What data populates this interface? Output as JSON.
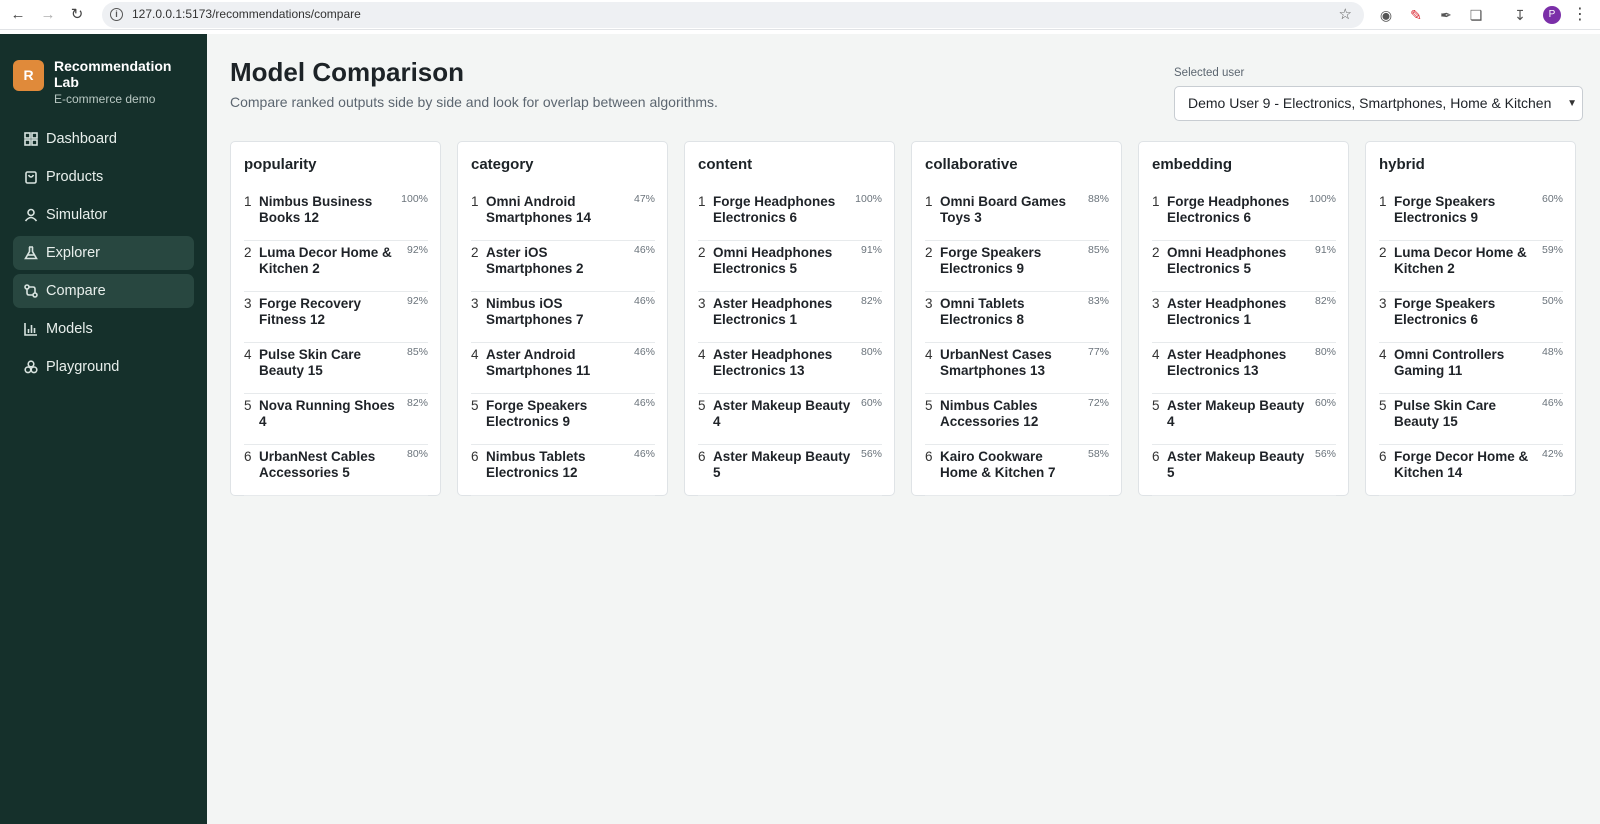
{
  "browser": {
    "url": "127.0.0.1:5173/recommendations/compare",
    "profile_initial": "P"
  },
  "sidebar": {
    "logo_letter": "R",
    "brand_title": "Recommendation Lab",
    "brand_subtitle": "E-commerce demo",
    "items": [
      {
        "label": "Dashboard",
        "icon": "dashboard-icon",
        "active": false
      },
      {
        "label": "Products",
        "icon": "bag-icon",
        "active": false
      },
      {
        "label": "Simulator",
        "icon": "user-icon",
        "active": false
      },
      {
        "label": "Explorer",
        "icon": "flask-icon",
        "active": true
      },
      {
        "label": "Compare",
        "icon": "compare-icon",
        "active": true
      },
      {
        "label": "Models",
        "icon": "bar-chart-icon",
        "active": false
      },
      {
        "label": "Playground",
        "icon": "circles-icon",
        "active": false
      }
    ]
  },
  "main": {
    "title": "Model Comparison",
    "subtitle": "Compare ranked outputs side by side and look for overlap between algorithms.",
    "user_select_label": "Selected user",
    "user_select_value": "Demo User 9 - Electronics, Smartphones, Home & Kitchen"
  },
  "models": [
    {
      "name": "popularity",
      "items": [
        {
          "rank": "1",
          "name": "Nimbus Business Books 12",
          "score": "100%"
        },
        {
          "rank": "2",
          "name": "Luma Decor Home & Kitchen 2",
          "score": "92%"
        },
        {
          "rank": "3",
          "name": "Forge Recovery Fitness 12",
          "score": "92%"
        },
        {
          "rank": "4",
          "name": "Pulse Skin Care Beauty 15",
          "score": "85%"
        },
        {
          "rank": "5",
          "name": "Nova Running Shoes 4",
          "score": "82%"
        },
        {
          "rank": "6",
          "name": "UrbanNest Cables Accessories 5",
          "score": "80%"
        }
      ]
    },
    {
      "name": "category",
      "items": [
        {
          "rank": "1",
          "name": "Omni Android Smartphones 14",
          "score": "47%"
        },
        {
          "rank": "2",
          "name": "Aster iOS Smartphones 2",
          "score": "46%"
        },
        {
          "rank": "3",
          "name": "Nimbus iOS Smartphones 7",
          "score": "46%"
        },
        {
          "rank": "4",
          "name": "Aster Android Smartphones 11",
          "score": "46%"
        },
        {
          "rank": "5",
          "name": "Forge Speakers Electronics 9",
          "score": "46%"
        },
        {
          "rank": "6",
          "name": "Nimbus Tablets Electronics 12",
          "score": "46%"
        }
      ]
    },
    {
      "name": "content",
      "items": [
        {
          "rank": "1",
          "name": "Forge Headphones Electronics 6",
          "score": "100%"
        },
        {
          "rank": "2",
          "name": "Omni Headphones Electronics 5",
          "score": "91%"
        },
        {
          "rank": "3",
          "name": "Aster Headphones Electronics 1",
          "score": "82%"
        },
        {
          "rank": "4",
          "name": "Aster Headphones Electronics 13",
          "score": "80%"
        },
        {
          "rank": "5",
          "name": "Aster Makeup Beauty 4",
          "score": "60%"
        },
        {
          "rank": "6",
          "name": "Aster Makeup Beauty 5",
          "score": "56%"
        }
      ]
    },
    {
      "name": "collaborative",
      "items": [
        {
          "rank": "1",
          "name": "Omni Board Games Toys 3",
          "score": "88%"
        },
        {
          "rank": "2",
          "name": "Forge Speakers Electronics 9",
          "score": "85%"
        },
        {
          "rank": "3",
          "name": "Omni Tablets Electronics 8",
          "score": "83%"
        },
        {
          "rank": "4",
          "name": "UrbanNest Cases Smartphones 13",
          "score": "77%"
        },
        {
          "rank": "5",
          "name": "Nimbus Cables Accessories 12",
          "score": "72%"
        },
        {
          "rank": "6",
          "name": "Kairo Cookware Home & Kitchen 7",
          "score": "58%"
        }
      ]
    },
    {
      "name": "embedding",
      "items": [
        {
          "rank": "1",
          "name": "Forge Headphones Electronics 6",
          "score": "100%"
        },
        {
          "rank": "2",
          "name": "Omni Headphones Electronics 5",
          "score": "91%"
        },
        {
          "rank": "3",
          "name": "Aster Headphones Electronics 1",
          "score": "82%"
        },
        {
          "rank": "4",
          "name": "Aster Headphones Electronics 13",
          "score": "80%"
        },
        {
          "rank": "5",
          "name": "Aster Makeup Beauty 4",
          "score": "60%"
        },
        {
          "rank": "6",
          "name": "Aster Makeup Beauty 5",
          "score": "56%"
        }
      ]
    },
    {
      "name": "hybrid",
      "items": [
        {
          "rank": "1",
          "name": "Forge Speakers Electronics 9",
          "score": "60%"
        },
        {
          "rank": "2",
          "name": "Luma Decor Home & Kitchen 2",
          "score": "59%"
        },
        {
          "rank": "3",
          "name": "Forge Speakers Electronics 6",
          "score": "50%"
        },
        {
          "rank": "4",
          "name": "Omni Controllers Gaming 11",
          "score": "48%"
        },
        {
          "rank": "5",
          "name": "Pulse Skin Care Beauty 15",
          "score": "46%"
        },
        {
          "rank": "6",
          "name": "Forge Decor Home & Kitchen 14",
          "score": "42%"
        }
      ]
    }
  ]
}
